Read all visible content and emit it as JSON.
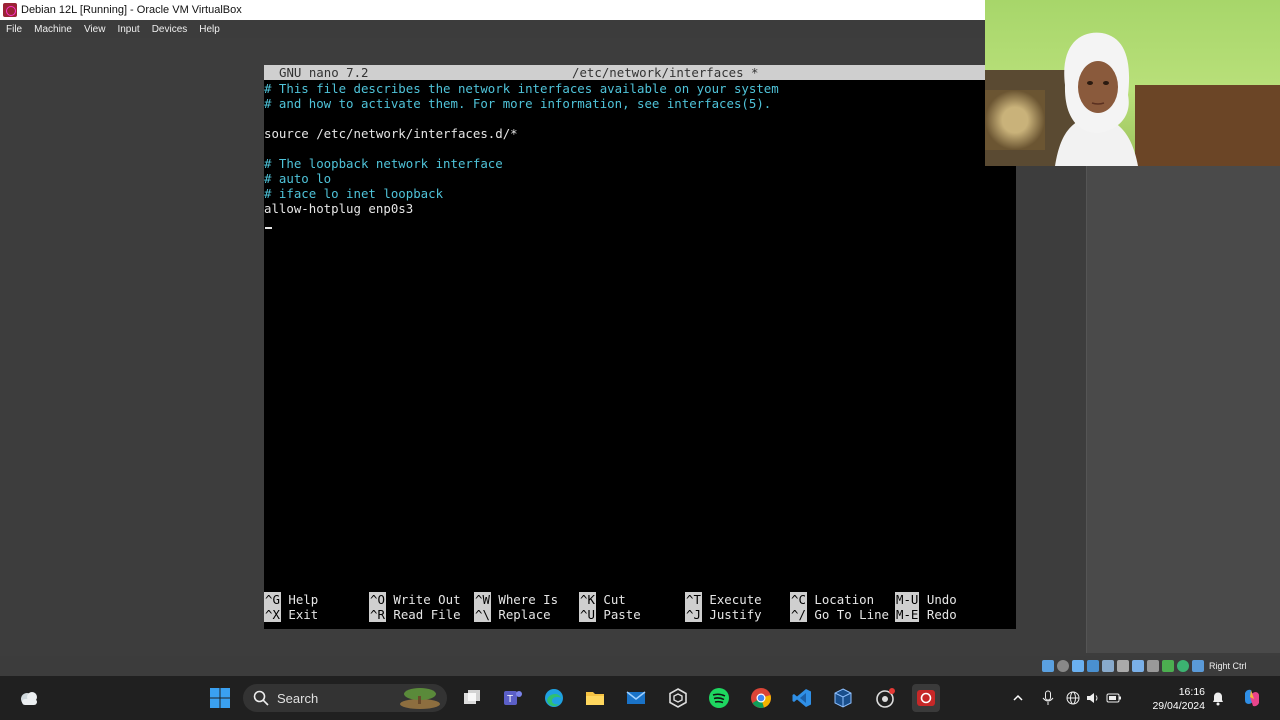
{
  "window": {
    "title": "Debian 12L [Running] - Oracle VM VirtualBox"
  },
  "menubar": {
    "items": [
      "File",
      "Machine",
      "View",
      "Input",
      "Devices",
      "Help"
    ]
  },
  "nano": {
    "version": "GNU nano 7.2",
    "filename": "/etc/network/interfaces *",
    "lines": [
      {
        "text": "# This file describes the network interfaces available on your system",
        "type": "comment"
      },
      {
        "text": "# and how to activate them. For more information, see interfaces(5).",
        "type": "comment"
      },
      {
        "text": "",
        "type": "text"
      },
      {
        "text": "source /etc/network/interfaces.d/*",
        "type": "text"
      },
      {
        "text": "",
        "type": "text"
      },
      {
        "text": "# The loopback network interface",
        "type": "comment"
      },
      {
        "text": "# auto lo",
        "type": "comment"
      },
      {
        "text": "# iface lo inet loopback",
        "type": "comment"
      },
      {
        "text": "allow-hotplug enp0s3",
        "type": "text"
      }
    ],
    "shortcuts": [
      {
        "key": "^G",
        "label": "Help"
      },
      {
        "key": "^X",
        "label": "Exit"
      },
      {
        "key": "^O",
        "label": "Write Out"
      },
      {
        "key": "^R",
        "label": "Read File"
      },
      {
        "key": "^W",
        "label": "Where Is"
      },
      {
        "key": "^\\",
        "label": "Replace"
      },
      {
        "key": "^K",
        "label": "Cut"
      },
      {
        "key": "^U",
        "label": "Paste"
      },
      {
        "key": "^T",
        "label": "Execute"
      },
      {
        "key": "^J",
        "label": "Justify"
      },
      {
        "key": "^C",
        "label": "Location"
      },
      {
        "key": "^/",
        "label": "Go To Line"
      },
      {
        "key": "M-U",
        "label": "Undo"
      },
      {
        "key": "M-E",
        "label": "Redo"
      }
    ]
  },
  "statusbar": {
    "host_key": "Right Ctrl"
  },
  "taskbar": {
    "search_label": "Search",
    "time": "16:16",
    "date": "29/04/2024",
    "apps": [
      "task-view",
      "teams",
      "edge",
      "file-explorer",
      "mail",
      "copilot-hex",
      "spotify",
      "chrome",
      "vscode",
      "virtualbox",
      "capture-app",
      "recording-app"
    ]
  },
  "colors": {
    "comment": "#4fc3d9",
    "terminal_bg": "#000000",
    "header_bg": "#cfcfcf",
    "taskbar_bg": "#202020"
  }
}
